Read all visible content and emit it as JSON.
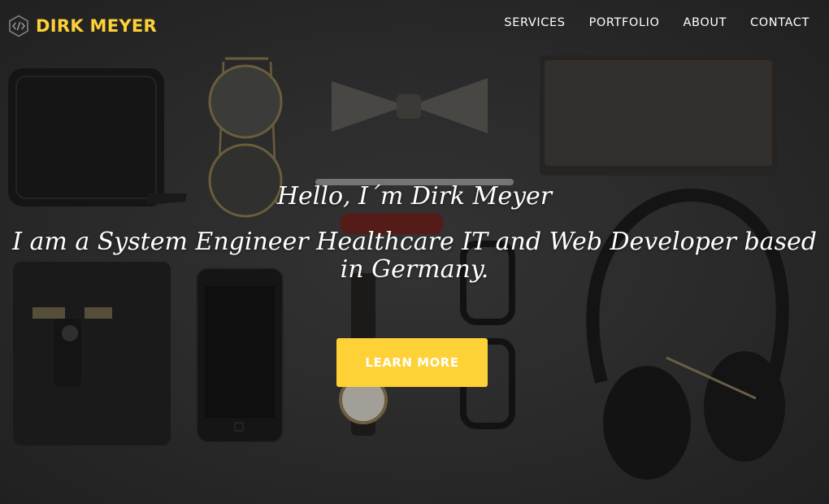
{
  "navbar": {
    "brand_icon": "code-hexagon-icon",
    "brand_name": "DIRK MEYER",
    "links": [
      {
        "label": "SERVICES"
      },
      {
        "label": "PORTFOLIO"
      },
      {
        "label": "ABOUT"
      },
      {
        "label": "CONTACT"
      }
    ]
  },
  "intro": {
    "lead_in": "Hello, I´m Dirk Meyer",
    "heading": "I am a System Engineer Healthcare IT and Web Developer based in Germany.",
    "button_label": "LEARN MORE"
  },
  "colors": {
    "accent": "#fed136",
    "text": "#ffffff",
    "background": "#333233"
  }
}
